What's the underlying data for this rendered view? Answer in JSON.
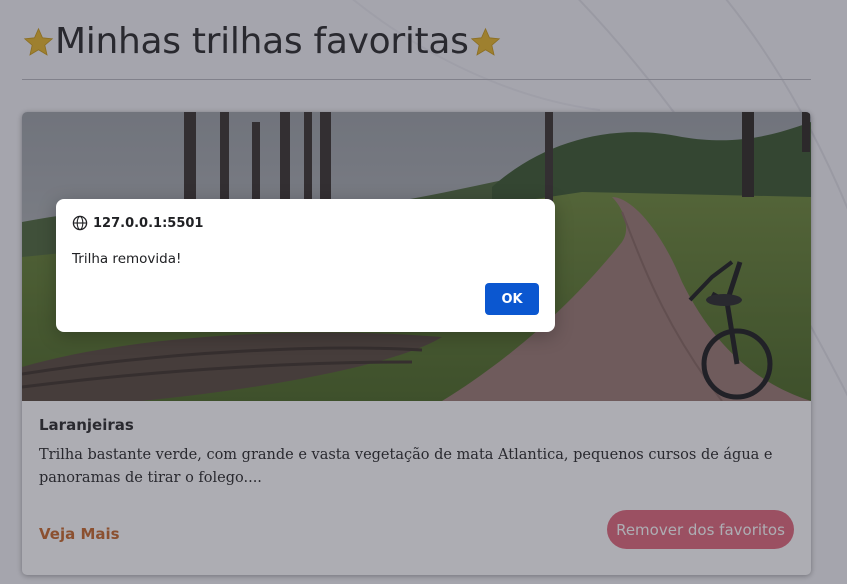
{
  "page": {
    "title": "Minhas trilhas favoritas",
    "title_icon": "star-icon"
  },
  "trail_card": {
    "image_alt": "trail-photo",
    "name": "Laranjeiras",
    "description": "Trilha bastante verde, com grande e vasta vegetação de mata Atlantica, pequenos cursos de água e panoramas de tirar o folego....",
    "see_more_label": "Veja Mais",
    "remove_label": "Remover dos favoritos"
  },
  "alert_dialog": {
    "origin": "127.0.0.1:5501",
    "origin_icon": "globe-icon",
    "message": "Trilha removida!",
    "ok_label": "OK"
  },
  "colors": {
    "accent_link": "#c9692c",
    "remove_button": "#e26a7c",
    "dialog_button": "#0b57d0",
    "star": "#e7b62a"
  }
}
